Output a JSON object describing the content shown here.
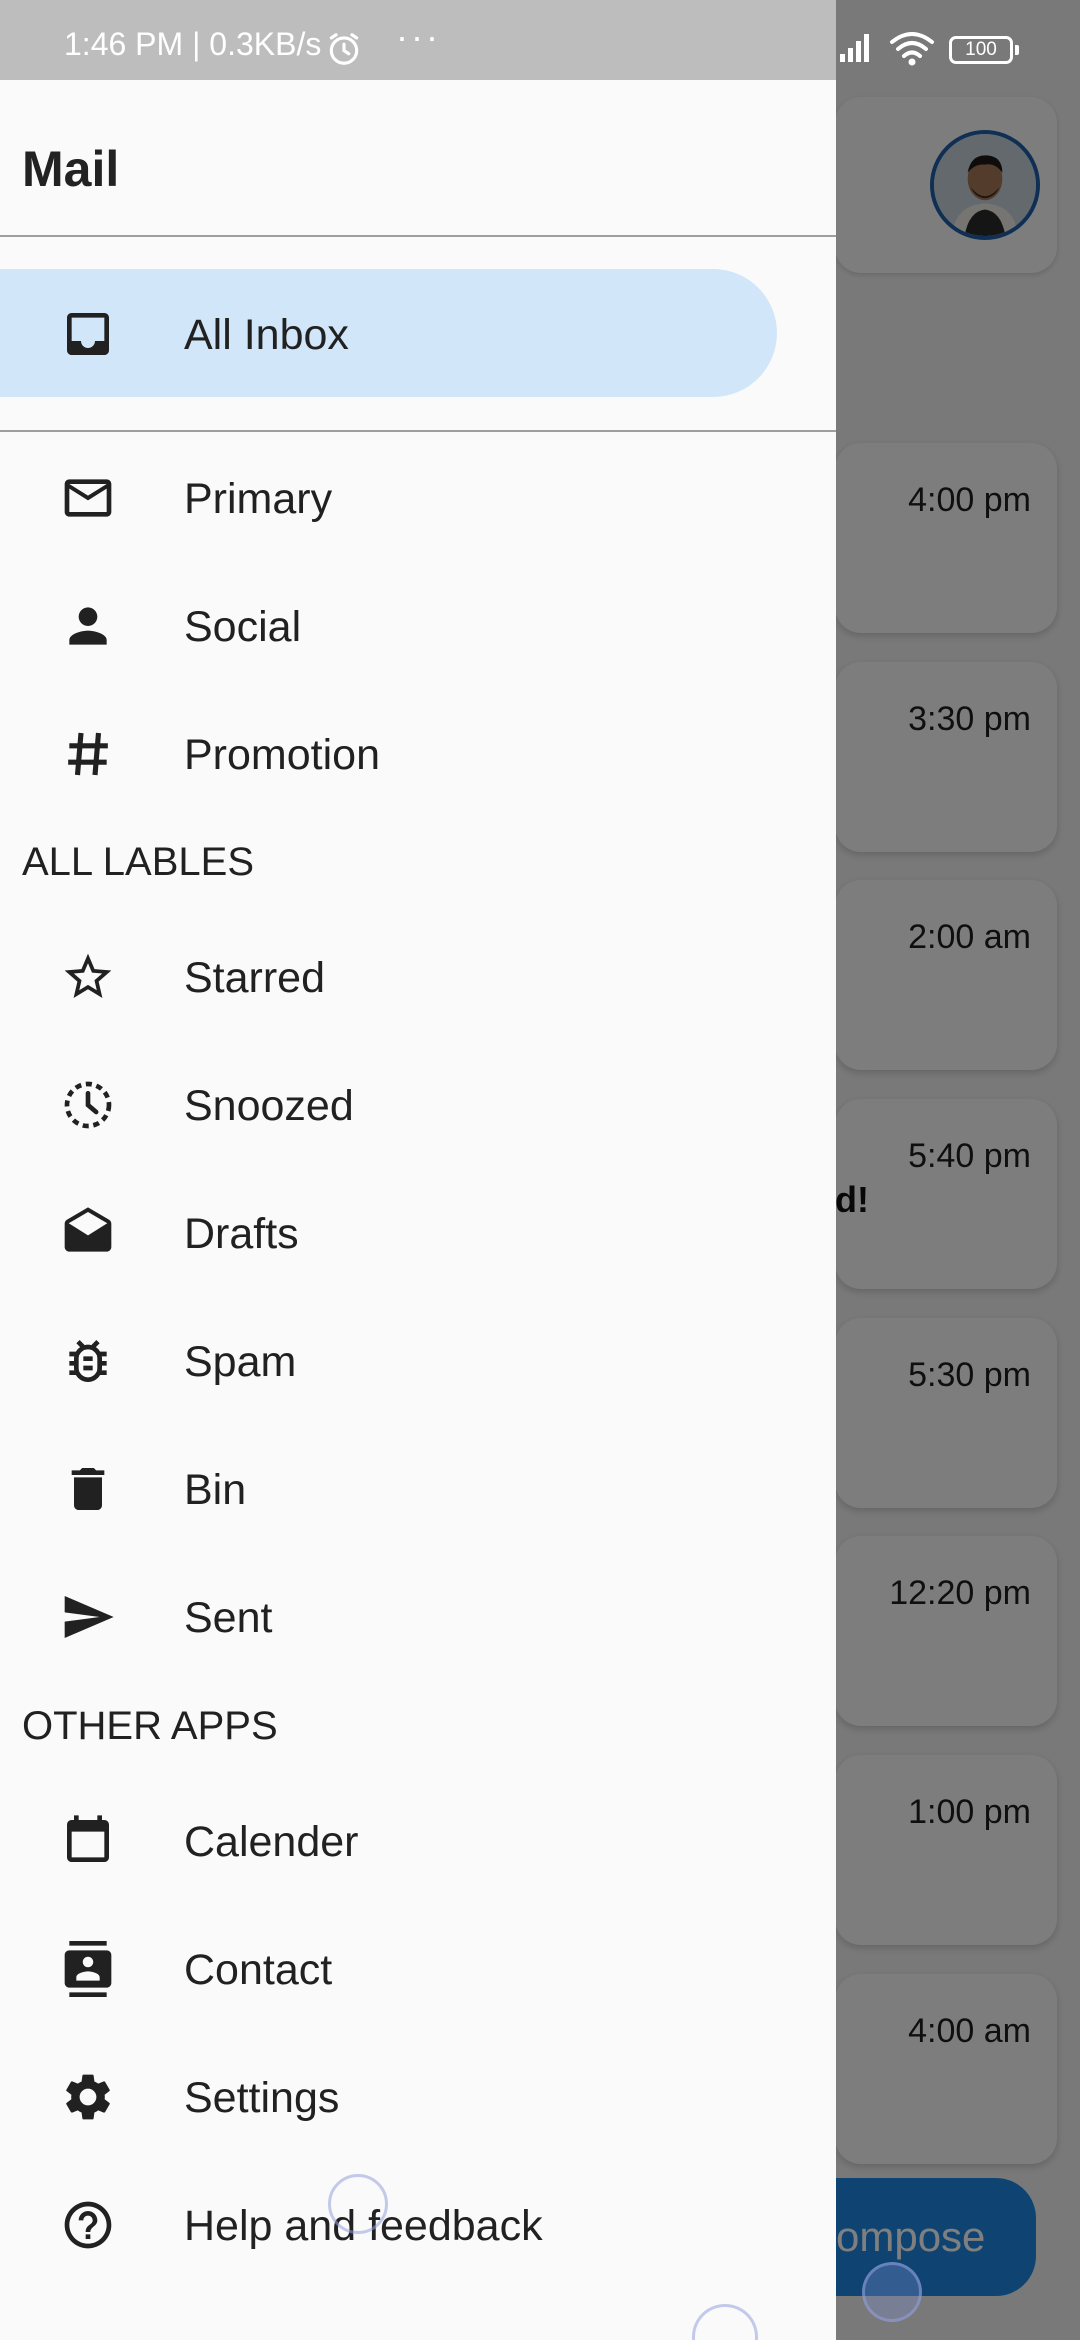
{
  "status_bar": {
    "time_speed": "1:46 PM | 0.3KB/s",
    "dots": "···",
    "battery": "100"
  },
  "drawer": {
    "title": "Mail",
    "selected": {
      "label": "All Inbox",
      "icon": "inbox-icon"
    },
    "categories": [
      {
        "label": "Primary",
        "icon": "mail-icon"
      },
      {
        "label": "Social",
        "icon": "person-icon"
      },
      {
        "label": "Promotion",
        "icon": "hashtag-icon"
      }
    ],
    "labels_header": "ALL LABLES",
    "labels": [
      {
        "label": "Starred",
        "icon": "star-icon"
      },
      {
        "label": "Snoozed",
        "icon": "snooze-clock-icon"
      },
      {
        "label": "Drafts",
        "icon": "drafts-icon"
      },
      {
        "label": "Spam",
        "icon": "bug-icon"
      },
      {
        "label": "Bin",
        "icon": "trash-icon"
      },
      {
        "label": "Sent",
        "icon": "send-icon"
      }
    ],
    "apps_header": "OTHER APPS",
    "apps": [
      {
        "label": "Calender",
        "icon": "calendar-icon"
      },
      {
        "label": "Contact",
        "icon": "contact-card-icon"
      },
      {
        "label": "Settings",
        "icon": "gear-icon"
      },
      {
        "label": "Help and feedback",
        "icon": "help-icon"
      }
    ]
  },
  "background": {
    "mail_times": [
      "4:00 pm",
      "3:30 pm",
      "2:00 am",
      "5:40 pm",
      "5:30 pm",
      "12:20 pm",
      "1:00 pm",
      "4:00 am"
    ],
    "partial_text": "d!",
    "compose_label": "ompose"
  },
  "colors": {
    "selected_bg": "#d1e6f9",
    "fab": "#1e88e5",
    "avatar_ring": "#1f5fa8"
  }
}
